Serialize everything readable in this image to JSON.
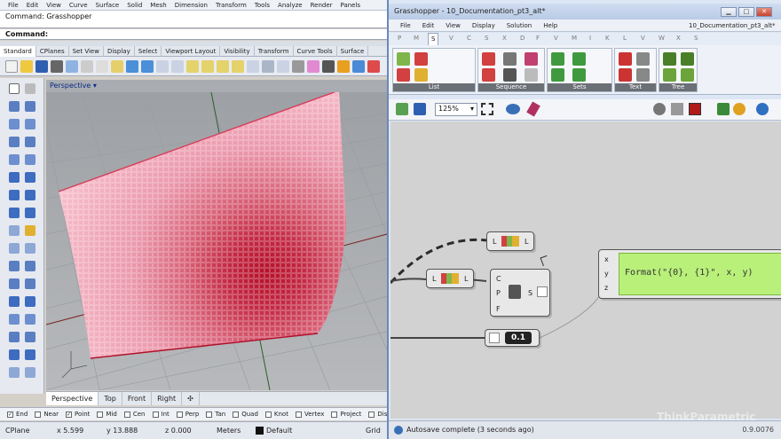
{
  "rhino": {
    "menu": [
      "File",
      "Edit",
      "View",
      "Curve",
      "Surface",
      "Solid",
      "Mesh",
      "Dimension",
      "Transform",
      "Tools",
      "Analyze",
      "Render",
      "Panels"
    ],
    "command_history": "Command: Grasshopper",
    "command_prompt": "Command:",
    "toolbar_tabs": [
      "Standard",
      "CPlanes",
      "Set View",
      "Display",
      "Select",
      "Viewport Layout",
      "Visibility",
      "Transform",
      "Curve Tools",
      "Surface"
    ],
    "viewport_title": "Perspective",
    "viewport_tabs": [
      "Perspective",
      "Top",
      "Front",
      "Right"
    ],
    "osnaps": [
      {
        "label": "End",
        "checked": true
      },
      {
        "label": "Near",
        "checked": false
      },
      {
        "label": "Point",
        "checked": true
      },
      {
        "label": "Mid",
        "checked": false
      },
      {
        "label": "Cen",
        "checked": false
      },
      {
        "label": "Int",
        "checked": false
      },
      {
        "label": "Perp",
        "checked": false
      },
      {
        "label": "Tan",
        "checked": false
      },
      {
        "label": "Quad",
        "checked": false
      },
      {
        "label": "Knot",
        "checked": false
      },
      {
        "label": "Vertex",
        "checked": false
      },
      {
        "label": "Project",
        "checked": false
      },
      {
        "label": "Disable",
        "checked": false
      }
    ],
    "status": {
      "cplane": "CPlane",
      "x": "x 5.599",
      "y": "y 13.888",
      "z": "z 0.000",
      "units": "Meters",
      "layer": "Default",
      "grid": "Grid S"
    }
  },
  "grasshopper": {
    "title": "Grasshopper - 10_Documentation_pt3_alt*",
    "doc_name": "10_Documentation_pt3_alt*",
    "menu": [
      "File",
      "Edit",
      "View",
      "Display",
      "Solution",
      "Help"
    ],
    "category_tabs": [
      "P",
      "M",
      "S",
      "V",
      "C",
      "S",
      "X",
      "D",
      "F",
      "V",
      "M",
      "I",
      "K",
      "L",
      "V",
      "W",
      "X",
      "S"
    ],
    "active_tab": "S",
    "groups": [
      "List",
      "Sequence",
      "Sets",
      "Text",
      "Tree"
    ],
    "zoom": "125%",
    "components": {
      "list_top": {
        "in": "L",
        "out": "L"
      },
      "list_mid": {
        "in": "L",
        "out": "L"
      },
      "series": {
        "inputs": [
          "C",
          "P",
          "F"
        ],
        "output": "S"
      },
      "slider_value": "0.1",
      "format": {
        "inputs": [
          "x",
          "y",
          "z"
        ],
        "text": "Format(\"{0}, {1}\", x, y)"
      }
    },
    "status_text": "Autosave complete (3 seconds ago)",
    "version": "0.9.0076",
    "watermark": "ThinkParametric"
  }
}
